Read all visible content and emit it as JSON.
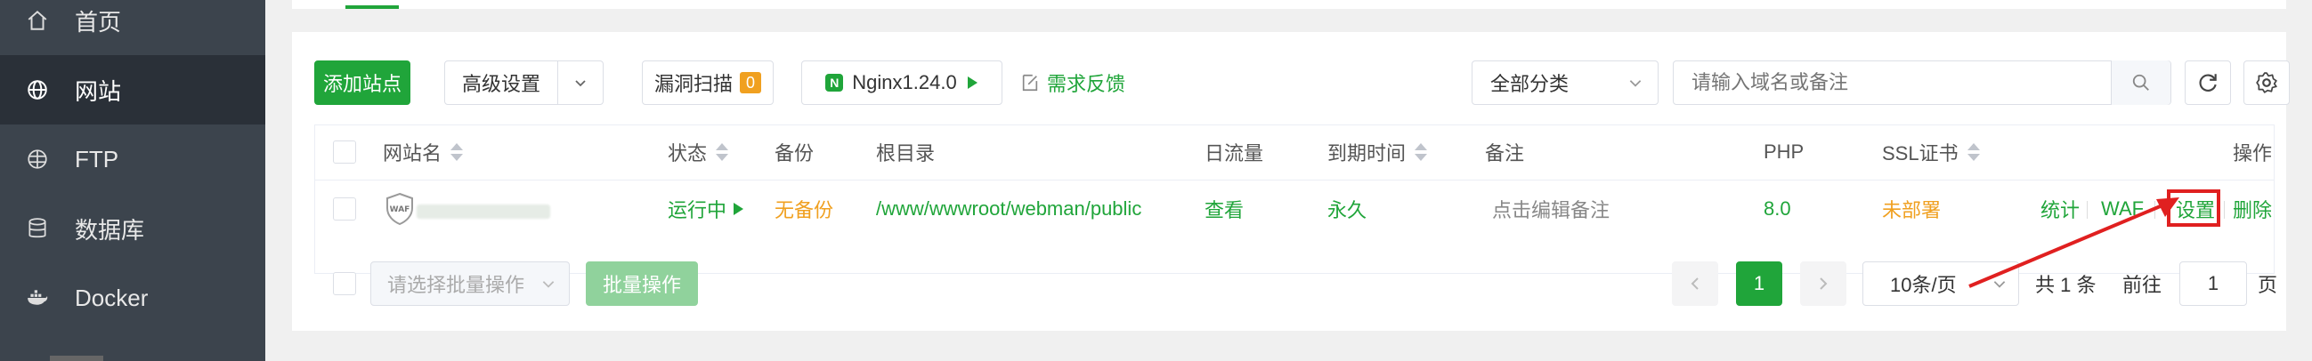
{
  "sidebar": {
    "items": [
      {
        "label": "首页",
        "icon": "home-icon"
      },
      {
        "label": "网站",
        "icon": "globe-icon"
      },
      {
        "label": "FTP",
        "icon": "ftp-globe-icon"
      },
      {
        "label": "数据库",
        "icon": "database-icon"
      },
      {
        "label": "Docker",
        "icon": "docker-icon"
      }
    ]
  },
  "toolbar": {
    "add_site": "添加站点",
    "advanced": "高级设置",
    "vuln_scan": "漏洞扫描",
    "vuln_count": "0",
    "nginx": "Nginx1.24.0",
    "feedback": "需求反馈",
    "category": "全部分类",
    "search_placeholder": "请输入域名或备注"
  },
  "table": {
    "headers": {
      "site_name": "网站名",
      "status": "状态",
      "backup": "备份",
      "root_dir": "根目录",
      "traffic": "日流量",
      "expire": "到期时间",
      "remark": "备注",
      "php": "PHP",
      "ssl": "SSL证书",
      "actions": "操作"
    },
    "rows": [
      {
        "status": "运行中",
        "backup": "无备份",
        "root": "/www/wwwroot/webman/public",
        "traffic": "查看",
        "expire": "永久",
        "remark": "点击编辑备注",
        "php": "8.0",
        "ssl": "未部署",
        "actions": {
          "stats": "统计",
          "waf": "WAF",
          "settings": "设置",
          "delete": "删除"
        }
      }
    ]
  },
  "footer": {
    "batch_placeholder": "请选择批量操作",
    "batch_button": "批量操作",
    "current_page": "1",
    "page_size": "10条/页",
    "total": "共 1 条",
    "goto_label": "前往",
    "goto_value": "1",
    "page_suffix": "页"
  },
  "colors": {
    "accent": "#20a53a",
    "warning": "#f0a020",
    "highlight": "#e02020",
    "sidebar_bg": "#3c444d"
  }
}
